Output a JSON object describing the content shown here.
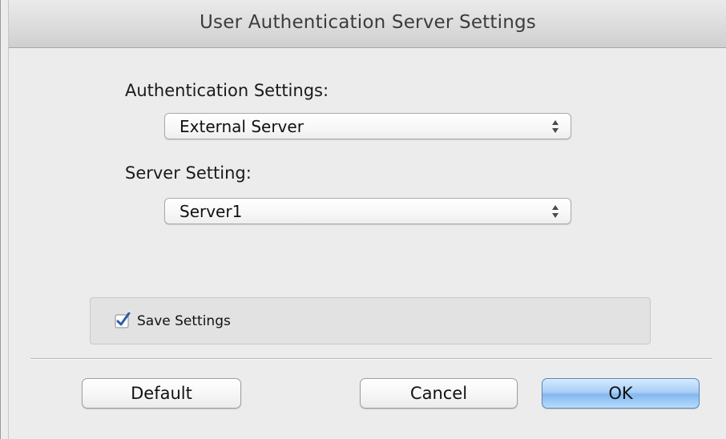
{
  "window": {
    "title": "User Authentication Server Settings"
  },
  "authentication": {
    "label": "Authentication Settings:",
    "selected": "External Server"
  },
  "server": {
    "label": "Server Setting:",
    "selected": "Server1"
  },
  "save_settings": {
    "label": "Save Settings",
    "checked": true
  },
  "buttons": {
    "default_label": "Default",
    "cancel_label": "Cancel",
    "ok_label": "OK"
  },
  "colors": {
    "window_bg": "#ececec",
    "accent": "#84b8f0",
    "checkmark": "#2a5ea8"
  }
}
